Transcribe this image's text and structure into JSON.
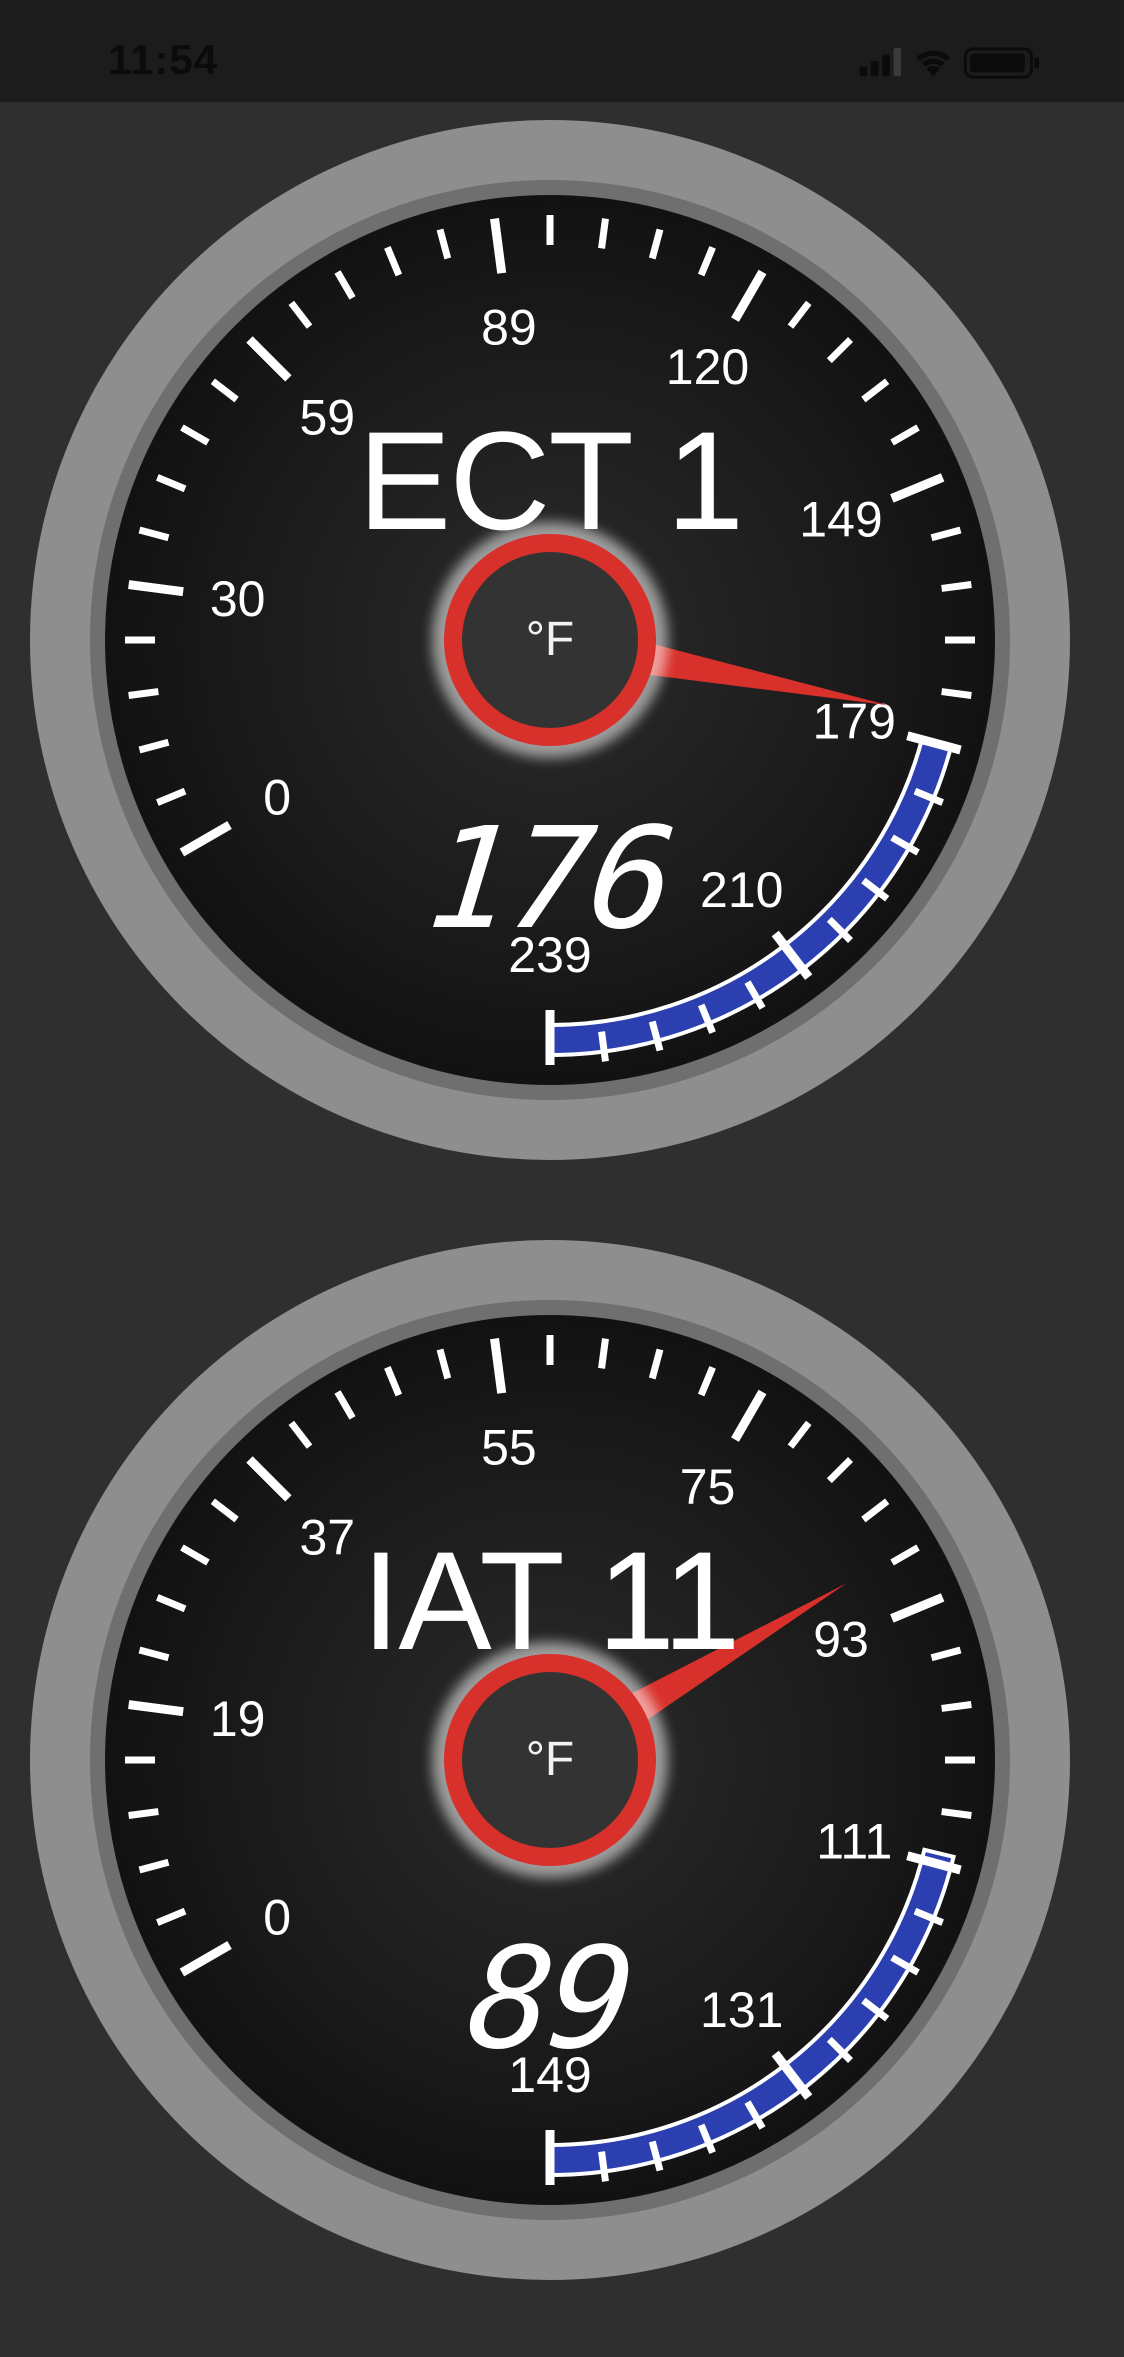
{
  "status_bar": {
    "time": "11:54",
    "icons": [
      "cellular-signal-icon",
      "wifi-icon",
      "battery-icon"
    ]
  },
  "gauges": [
    {
      "title": "ECT 1",
      "unit": "°F",
      "value": "176",
      "value_numeric": 176,
      "min": 0,
      "max": 239,
      "scale_labels": [
        "0",
        "30",
        "59",
        "89",
        "120",
        "149",
        "179",
        "210",
        "239"
      ],
      "warning_zone": {
        "from": 179,
        "to": 239,
        "color": "#2b3fb0"
      },
      "needle_color": "#d8302a",
      "hub_color": "#d8302a"
    },
    {
      "title": "IAT 11",
      "unit": "°F",
      "value": "89",
      "value_numeric": 89,
      "min": 0,
      "max": 149,
      "scale_labels": [
        "0",
        "19",
        "37",
        "55",
        "75",
        "93",
        "111",
        "131",
        "149"
      ],
      "warning_zone": {
        "from": 111,
        "to": 149,
        "color": "#2b3fb0"
      },
      "needle_color": "#d8302a",
      "hub_color": "#d8302a"
    }
  ]
}
